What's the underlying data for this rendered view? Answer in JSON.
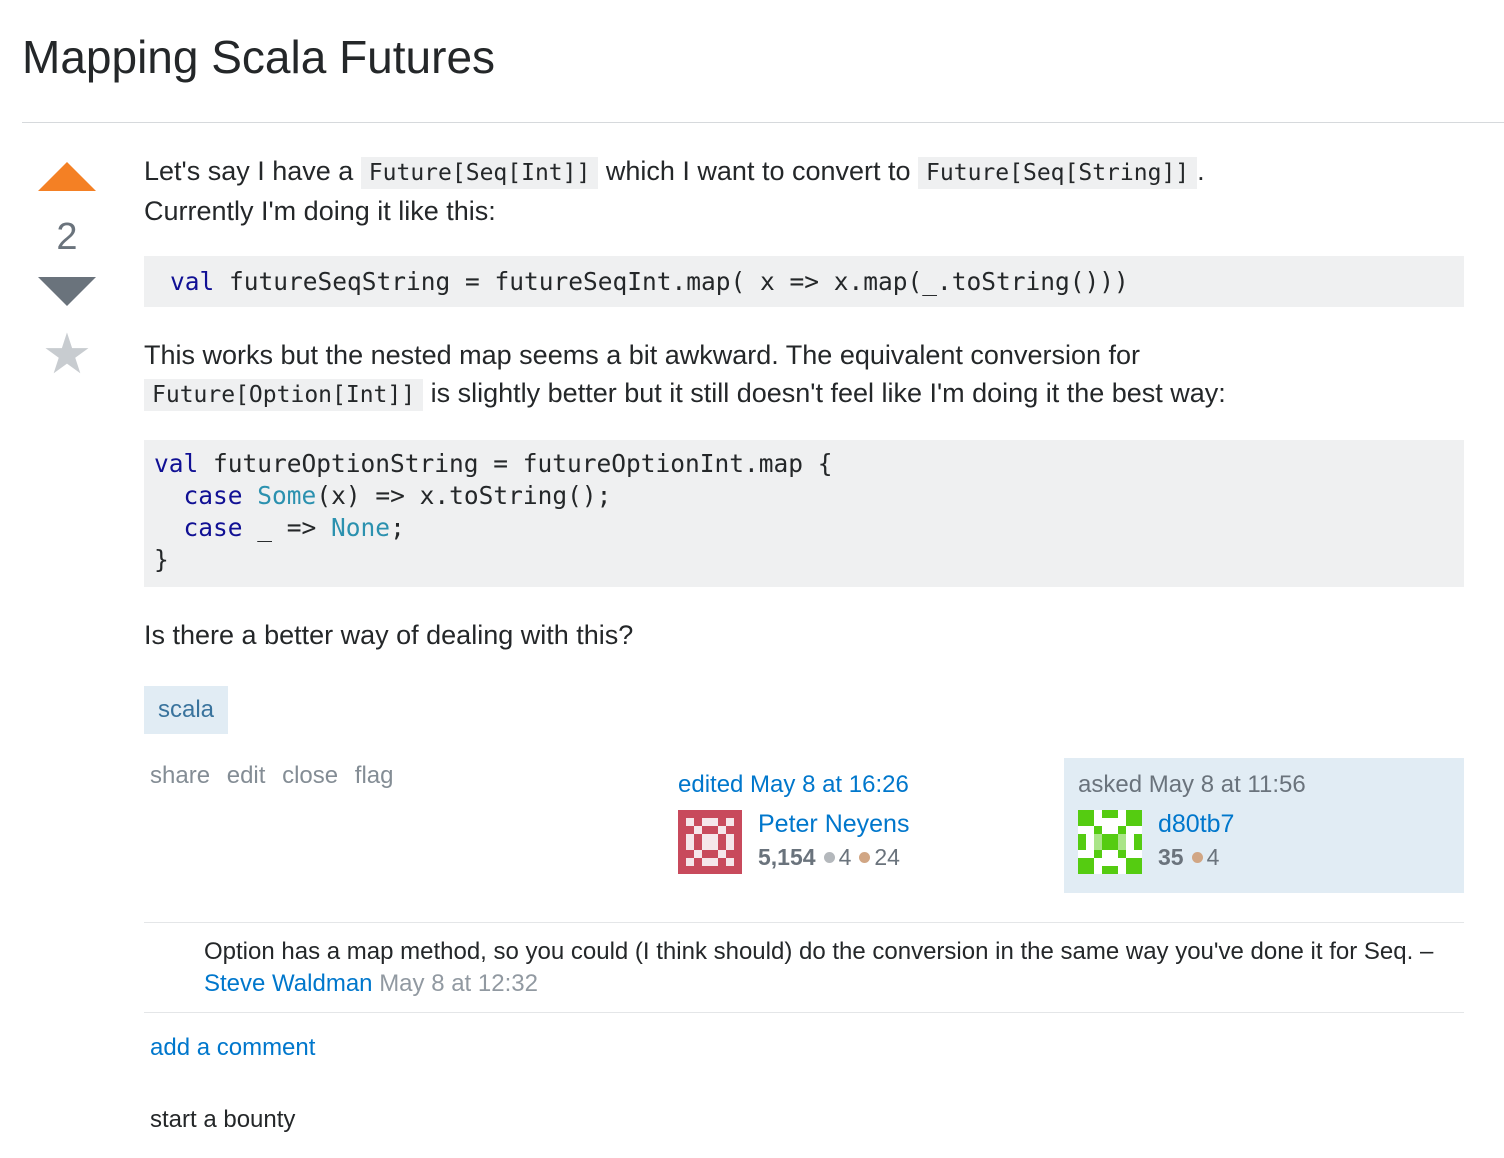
{
  "question": {
    "title": "Mapping Scala Futures",
    "votes": "2",
    "body": {
      "p1_a": "Let's say I have a",
      "p1_code1": "Future[Seq[Int]]",
      "p1_b": "which I want to convert to",
      "p1_code2": "Future[Seq[String]]",
      "p1_c": ".",
      "p1_line2": "Currently I'm doing it like this:",
      "code1_kw": "val",
      "code1_rest": " futureSeqString = futureSeqInt.map( x => x.map(_.toString()))",
      "p2_line1": "This works but the nested map seems a bit awkward. The equivalent conversion for",
      "p2_code": "Future[Option[Int]]",
      "p2_b": "is slightly better but it still doesn't feel like I'm doing it the best way:",
      "code2": {
        "l1_kw": "val",
        "l1_rest": " futureOptionString = futureOptionInt.map {",
        "l2_kw": "case",
        "l2_ty": "Some",
        "l2_rest": "(x) => x.toString();",
        "l3_kw": "case",
        "l3_mid": " _ => ",
        "l3_ty": "None",
        "l3_end": ";",
        "l4": "}"
      },
      "p3": "Is there a better way of dealing with this?"
    },
    "tags": [
      "scala"
    ],
    "menu": [
      "share",
      "edit",
      "close",
      "flag"
    ],
    "editor": {
      "action": "edited May 8 at 16:26",
      "name": "Peter Neyens",
      "rep": "5,154",
      "silver": "4",
      "bronze": "24"
    },
    "owner": {
      "action": "asked May 8 at 11:56",
      "name": "d80tb7",
      "rep": "35",
      "bronze": "4"
    }
  },
  "comments": [
    {
      "text": "Option has a map method, so you could (I think should) do the conversion in the same way you've done it for Seq. –",
      "user": "Steve Waldman",
      "date": "May 8 at 12:32"
    }
  ],
  "add_comment_label": "add a comment",
  "bounty_label": "start a bounty",
  "colors": {
    "upvote": "#f48024",
    "link": "#0077cc",
    "tag_bg": "#e1ecf4",
    "code_bg": "#eff0f1"
  }
}
